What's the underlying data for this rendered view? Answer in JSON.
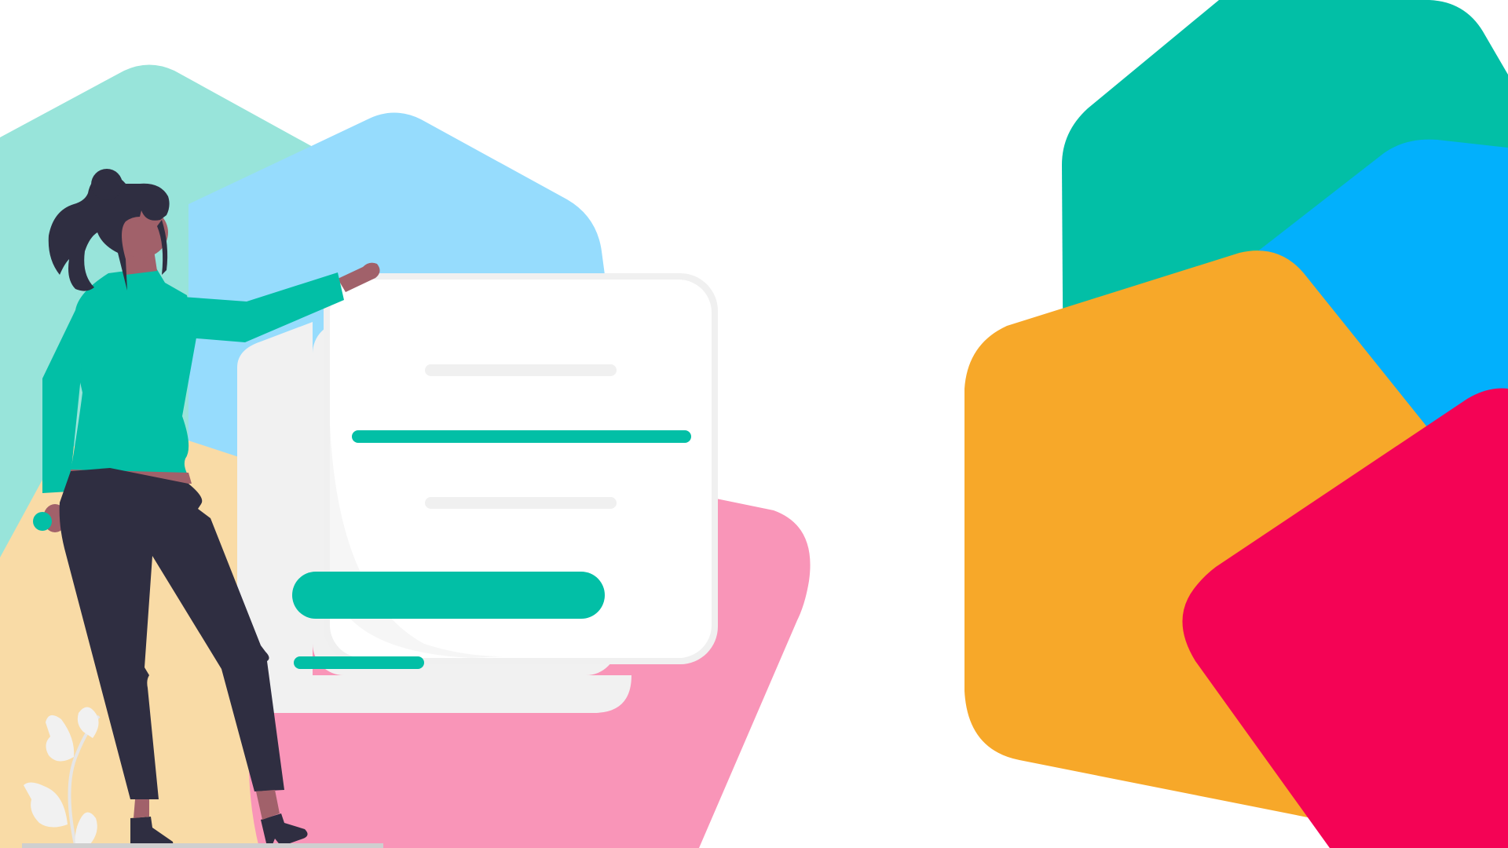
{
  "colors": {
    "background": "#ffffff",
    "mint_light": "#98e4da",
    "sky_light": "#96dcfd",
    "peach_light": "#f9dba6",
    "pink_light": "#f995b8",
    "teal": "#02bfa6",
    "blue": "#02b0fc",
    "orange": "#f7a829",
    "crimson": "#f40355",
    "card_white": "#ffffff",
    "card_gray": "#f1f1f1",
    "line_gray": "#f0f0f0",
    "skin": "#a1616a",
    "hair_dark": "#2f2e41",
    "pants_dark": "#2f2e41",
    "plant": "#f1f1f1"
  },
  "illustration": {
    "subject": "person-pointing-at-form",
    "form_fields": [
      "field-placeholder-1",
      "field-active",
      "field-placeholder-2"
    ],
    "form_button": "submit-button-graphic"
  }
}
